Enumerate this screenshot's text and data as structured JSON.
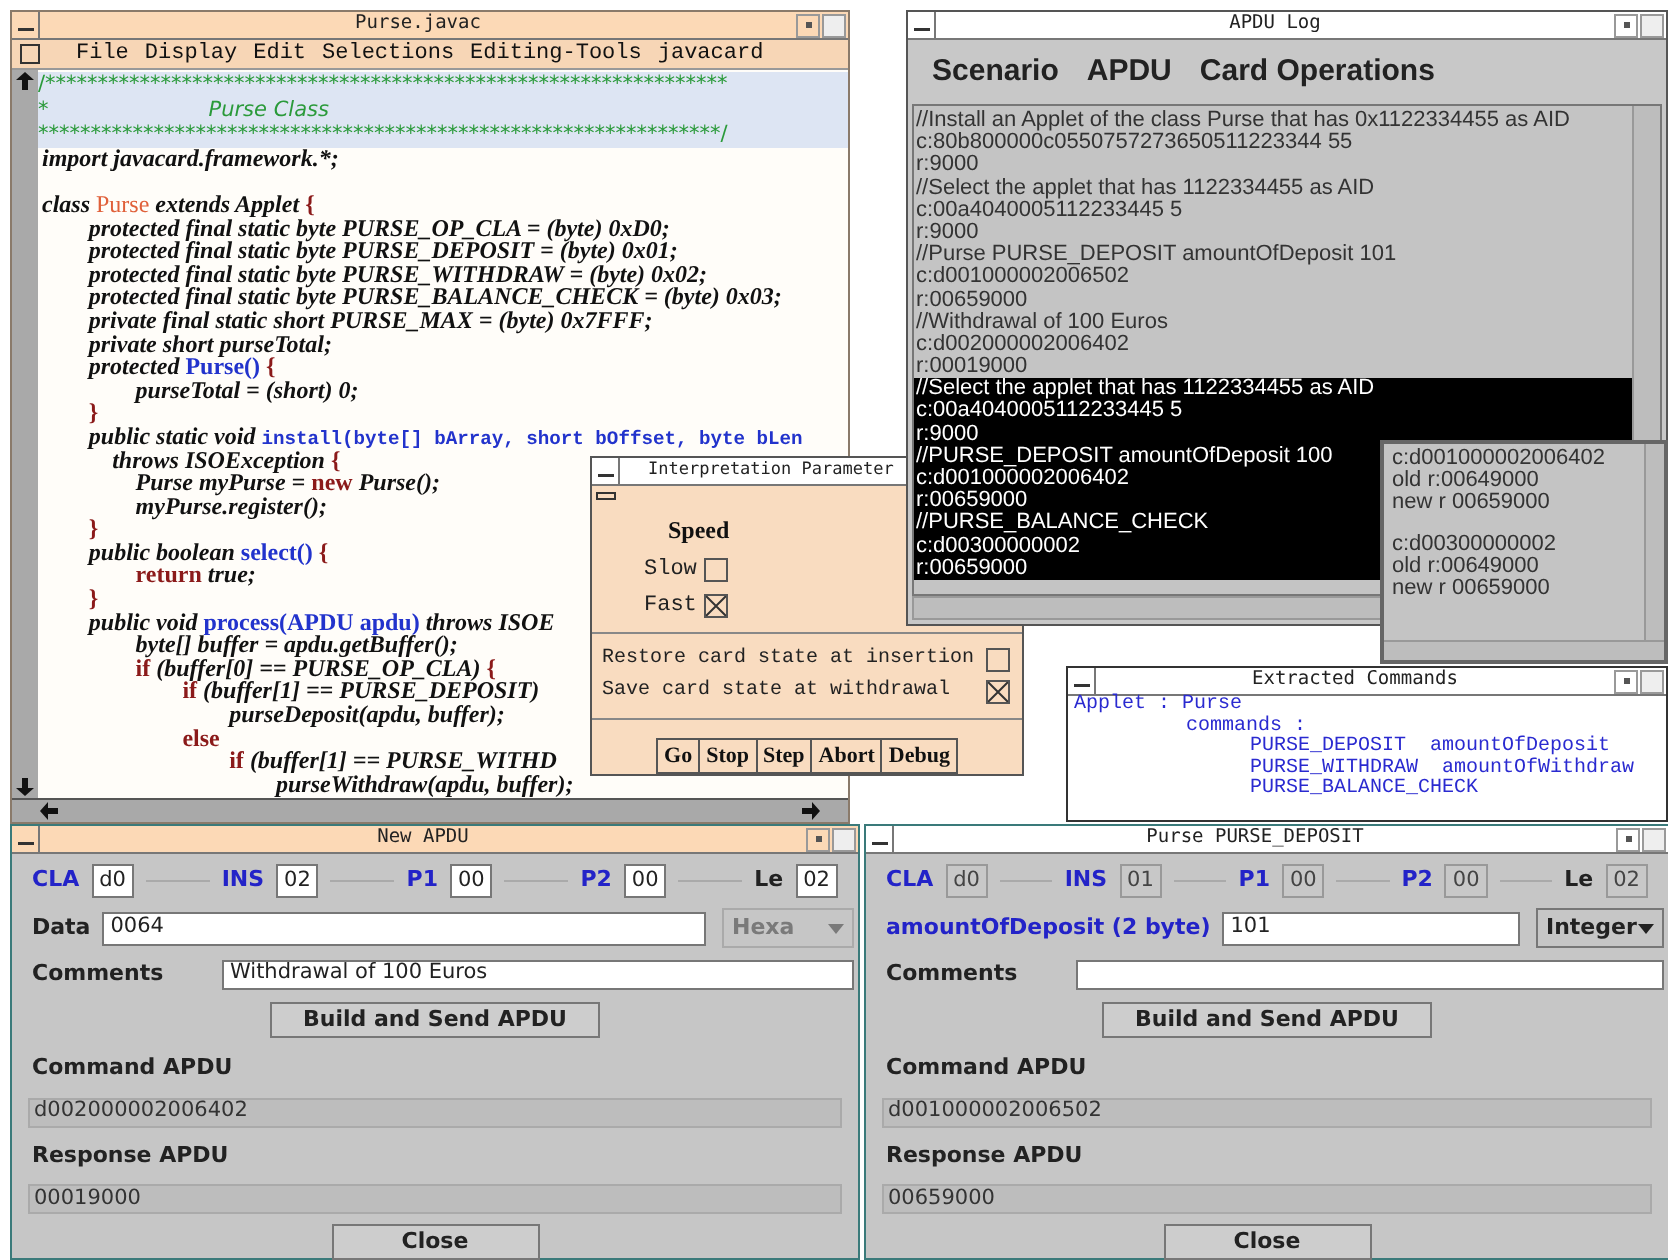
{
  "editor": {
    "title": "Purse.javac",
    "active": true,
    "menu": [
      "File",
      "Display",
      "Edit",
      "Selections",
      "Editing-Tools",
      "javacard"
    ],
    "code": [
      {
        "kind": "comment",
        "text": "/*****************************************************************"
      },
      {
        "kind": "comment",
        "text": "*",
        "caption": "Purse Class"
      },
      {
        "kind": "comment",
        "text": "*****************************************************************/"
      },
      {
        "kind": "code",
        "segments": [
          {
            "kind": "plain",
            "text": "import javacard.framework.*;"
          }
        ]
      },
      {
        "kind": "blank"
      },
      {
        "kind": "code",
        "segments": [
          {
            "kind": "plain",
            "text": "class "
          },
          {
            "kind": "class",
            "text": "Purse"
          },
          {
            "kind": "plain",
            "text": " extends Applet "
          },
          {
            "kind": "keyword",
            "text": "{"
          }
        ]
      },
      {
        "kind": "code",
        "segments": [
          {
            "kind": "plain",
            "text": "    protected final static byte PURSE_OP_CLA = (byte) 0xD0;"
          }
        ]
      },
      {
        "kind": "code",
        "segments": [
          {
            "kind": "plain",
            "text": "    protected final static byte PURSE_DEPOSIT = (byte) 0x01;"
          }
        ]
      },
      {
        "kind": "code",
        "segments": [
          {
            "kind": "plain",
            "text": "    protected final static byte PURSE_WITHDRAW = (byte) 0x02;"
          }
        ]
      },
      {
        "kind": "code",
        "segments": [
          {
            "kind": "plain",
            "text": "    protected final static byte PURSE_BALANCE_CHECK = (byte) 0x03;"
          }
        ]
      },
      {
        "kind": "code",
        "segments": [
          {
            "kind": "plain",
            "text": "    private final static short PURSE_MAX = (byte) 0x7FFF;"
          }
        ]
      },
      {
        "kind": "code",
        "segments": [
          {
            "kind": "plain",
            "text": "    private short purseTotal;"
          }
        ]
      },
      {
        "kind": "code",
        "segments": [
          {
            "kind": "plain",
            "text": "    protected "
          },
          {
            "kind": "name",
            "text": "Purse()"
          },
          {
            "kind": "keyword",
            "text": " {"
          }
        ]
      },
      {
        "kind": "code",
        "segments": [
          {
            "kind": "plain",
            "text": "        purseTotal = (short) 0;"
          }
        ]
      },
      {
        "kind": "code",
        "segments": [
          {
            "kind": "keyword",
            "text": "    }"
          }
        ]
      },
      {
        "kind": "code",
        "segments": [
          {
            "kind": "plain",
            "text": "    public static void "
          },
          {
            "kind": "signature",
            "text": "install(byte[] bArray, short bOffset, byte bLen"
          }
        ]
      },
      {
        "kind": "code",
        "segments": [
          {
            "kind": "plain",
            "text": "      throws ISOException "
          },
          {
            "kind": "keyword",
            "text": "{"
          }
        ]
      },
      {
        "kind": "code",
        "segments": [
          {
            "kind": "plain",
            "text": "        Purse myPurse = "
          },
          {
            "kind": "keyword",
            "text": "new"
          },
          {
            "kind": "plain",
            "text": " Purse();"
          }
        ]
      },
      {
        "kind": "code",
        "segments": [
          {
            "kind": "plain",
            "text": "        myPurse.register();"
          }
        ]
      },
      {
        "kind": "code",
        "segments": [
          {
            "kind": "keyword",
            "text": "    }"
          }
        ]
      },
      {
        "kind": "code",
        "segments": [
          {
            "kind": "plain",
            "text": "    public boolean "
          },
          {
            "kind": "name",
            "text": "select()"
          },
          {
            "kind": "keyword",
            "text": " {"
          }
        ]
      },
      {
        "kind": "code",
        "segments": [
          {
            "kind": "keyword",
            "text": "        return"
          },
          {
            "kind": "plain",
            "text": " true;"
          }
        ]
      },
      {
        "kind": "code",
        "segments": [
          {
            "kind": "keyword",
            "text": "    }"
          }
        ]
      },
      {
        "kind": "code",
        "segments": [
          {
            "kind": "plain",
            "text": "    public void "
          },
          {
            "kind": "name",
            "text": "process(APDU apdu)"
          },
          {
            "kind": "plain",
            "text": " throws ISOE"
          }
        ]
      },
      {
        "kind": "code",
        "segments": [
          {
            "kind": "plain",
            "text": "        byte[] buffer = apdu.getBuffer();"
          }
        ]
      },
      {
        "kind": "code",
        "segments": [
          {
            "kind": "keyword",
            "text": "        if"
          },
          {
            "kind": "plain",
            "text": " (buffer[0] == PURSE_OP_CLA) "
          },
          {
            "kind": "keyword",
            "text": "{"
          }
        ]
      },
      {
        "kind": "code",
        "segments": [
          {
            "kind": "keyword",
            "text": "            if"
          },
          {
            "kind": "plain",
            "text": " (buffer[1] == PURSE_DEPOSIT)"
          }
        ]
      },
      {
        "kind": "code",
        "segments": [
          {
            "kind": "plain",
            "text": "                purseDeposit(apdu, buffer);"
          }
        ]
      },
      {
        "kind": "code",
        "segments": [
          {
            "kind": "keyword",
            "text": "            else"
          }
        ]
      },
      {
        "kind": "code",
        "segments": [
          {
            "kind": "keyword",
            "text": "                if"
          },
          {
            "kind": "plain",
            "text": " (buffer[1] == PURSE_WITHD"
          }
        ]
      },
      {
        "kind": "code",
        "segments": [
          {
            "kind": "plain",
            "text": "                    purseWithdraw(apdu, buffer);"
          }
        ]
      }
    ]
  },
  "interpretation": {
    "title": "Interpretation Parameter",
    "active": false,
    "speed_label": "Speed",
    "speed_options": [
      {
        "label": "Slow",
        "checked": false
      },
      {
        "label": "Fast",
        "checked": true
      }
    ],
    "options": [
      {
        "label": "Restore card state at insertion",
        "checked": false
      },
      {
        "label": "Save card state at withdrawal",
        "checked": true
      }
    ],
    "buttons": [
      "Go",
      "Stop",
      "Step",
      "Abort",
      "Debug"
    ]
  },
  "apdu_log": {
    "title": "APDU Log",
    "active": false,
    "menu": [
      "Scenario",
      "APDU",
      "Card Operations"
    ],
    "lines": [
      {
        "text": "//Install an Applet of the class Purse that has 0x1122334455 as AID",
        "selected": false
      },
      {
        "text": "c:80b800000c0550757273650511223344 55",
        "selected": false
      },
      {
        "text": "r:9000",
        "selected": false
      },
      {
        "text": "//Select the applet that has 1122334455 as AID",
        "selected": false
      },
      {
        "text": "c:00a4040005112233445 5",
        "selected": false
      },
      {
        "text": "r:9000",
        "selected": false
      },
      {
        "text": "//Purse PURSE_DEPOSIT amountOfDeposit 101",
        "selected": false
      },
      {
        "text": "c:d001000002006502",
        "selected": false
      },
      {
        "text": "r:00659000",
        "selected": false
      },
      {
        "text": "//Withdrawal of 100 Euros",
        "selected": false
      },
      {
        "text": "c:d002000002006402",
        "selected": false
      },
      {
        "text": "r:00019000",
        "selected": false
      },
      {
        "text": "//Select the applet that has 1122334455 as AID",
        "selected": true
      },
      {
        "text": "c:00a4040005112233445 5",
        "selected": true
      },
      {
        "text": "r:9000",
        "selected": true
      },
      {
        "text": "//PURSE_DEPOSIT amountOfDeposit 100",
        "selected": true
      },
      {
        "text": "c:d001000002006402",
        "selected": true
      },
      {
        "text": "r:00659000",
        "selected": true
      },
      {
        "text": "//PURSE_BALANCE_CHECK",
        "selected": true
      },
      {
        "text": "c:d00300000002",
        "selected": true
      },
      {
        "text": "r:00659000",
        "selected": true
      }
    ]
  },
  "comparison_pane": {
    "entries": [
      {
        "command": "c:d001000002006402",
        "old": "old r:00649000",
        "new": "new r 00659000"
      },
      {
        "command": "c:d00300000002",
        "old": "old r:00649000",
        "new": "new r 00659000"
      }
    ]
  },
  "extracted_commands": {
    "title": "Extracted Commands",
    "active": false,
    "applet_line": "Applet : Purse",
    "commands_line": "commands :",
    "commands": [
      {
        "name": "PURSE_DEPOSIT",
        "param": "amountOfDeposit"
      },
      {
        "name": "PURSE_WITHDRAW",
        "param": "amountOfWithdraw"
      },
      {
        "name": "PURSE_BALANCE_CHECK"
      }
    ]
  },
  "new_apdu": {
    "title": "New APDU",
    "active": true,
    "header_fields": [
      {
        "label": "CLA",
        "value": "d0",
        "color": "#2323c8",
        "disabled": false
      },
      {
        "label": "INS",
        "value": "02",
        "color": "#2323c8",
        "disabled": false
      },
      {
        "label": "P1",
        "value": "00",
        "color": "#2323c8",
        "disabled": false
      },
      {
        "label": "P2",
        "value": "00",
        "color": "#2323c8",
        "disabled": false
      },
      {
        "label": "Le",
        "value": "02",
        "color": "#222222",
        "disabled": false
      }
    ],
    "data_row": {
      "label": "Data",
      "value": "0064",
      "color": "#222222",
      "format": "Hexa",
      "format_disabled": true
    },
    "comments": {
      "label": "Comments",
      "value": "Withdrawal of 100 Euros"
    },
    "build_button": "Build and Send APDU",
    "command": {
      "label": "Command APDU",
      "value": "d002000002006402"
    },
    "response": {
      "label": "Response APDU",
      "value": "00019000"
    },
    "close_button": "Close"
  },
  "purse_deposit": {
    "title": "Purse PURSE_DEPOSIT",
    "active": false,
    "header_fields": [
      {
        "label": "CLA",
        "value": "d0",
        "color": "#2323c8",
        "disabled": true
      },
      {
        "label": "INS",
        "value": "01",
        "color": "#2323c8",
        "disabled": true
      },
      {
        "label": "P1",
        "value": "00",
        "color": "#2323c8",
        "disabled": true
      },
      {
        "label": "P2",
        "value": "00",
        "color": "#2323c8",
        "disabled": true
      },
      {
        "label": "Le",
        "value": "02",
        "color": "#222222",
        "disabled": true
      }
    ],
    "data_row": {
      "label": "amountOfDeposit (2 byte)",
      "value": "101",
      "color": "#2323c8",
      "format": "Integer",
      "format_disabled": false
    },
    "comments": {
      "label": "Comments"
    },
    "build_button": "Build and Send APDU",
    "command": {
      "label": "Command APDU",
      "value": "d001000002006502"
    },
    "response": {
      "label": "Response APDU",
      "value": "00659000"
    },
    "close_button": "Close"
  }
}
